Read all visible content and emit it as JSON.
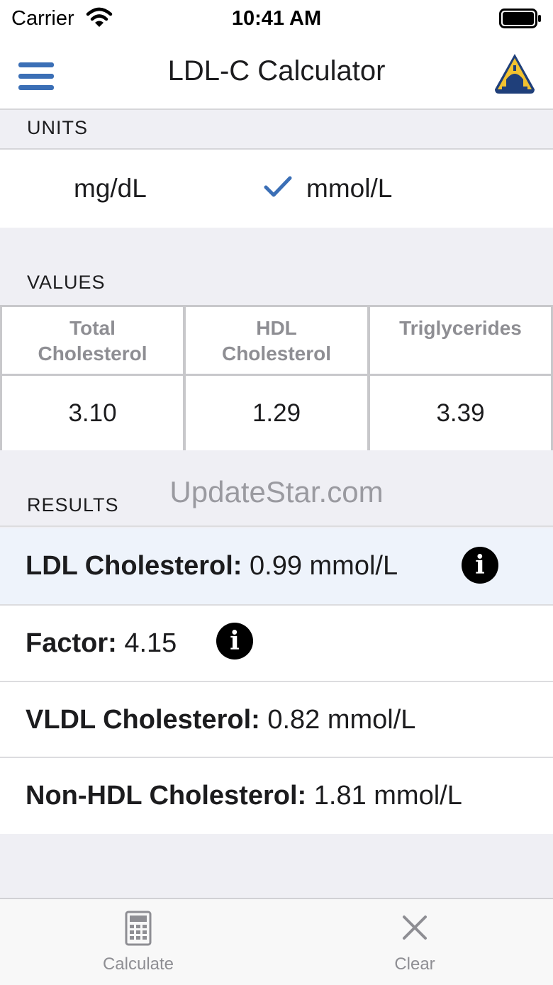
{
  "status_bar": {
    "carrier": "Carrier",
    "time": "10:41 AM"
  },
  "nav": {
    "title": "LDL-C Calculator",
    "menu_icon": "hamburger-menu-icon",
    "logo_icon": "dome-shield-logo"
  },
  "units": {
    "header": "UNITS",
    "options": [
      {
        "label": "mg/dL",
        "selected": false
      },
      {
        "label": "mmol/L",
        "selected": true
      }
    ]
  },
  "values": {
    "header": "VALUES",
    "columns": [
      {
        "line1": "Total",
        "line2": "Cholesterol",
        "value": "3.10"
      },
      {
        "line1": "HDL",
        "line2": "Cholesterol",
        "value": "1.29"
      },
      {
        "line1": "Triglycerides",
        "line2": "",
        "value": "3.39"
      }
    ]
  },
  "results": {
    "header": "RESULTS",
    "watermark": "UpdateStar.com",
    "rows": [
      {
        "label": "LDL Cholesterol:",
        "value": "0.99 mmol/L",
        "has_info": true,
        "highlighted": true
      },
      {
        "label": "Factor:",
        "value": "4.15",
        "has_info": true,
        "highlighted": false
      },
      {
        "label": "VLDL Cholesterol:",
        "value": "0.82 mmol/L",
        "has_info": false,
        "highlighted": false
      },
      {
        "label": "Non-HDL Cholesterol:",
        "value": "1.81 mmol/L",
        "has_info": false,
        "highlighted": false
      }
    ]
  },
  "tab_bar": {
    "calculate": "Calculate",
    "clear": "Clear"
  },
  "colors": {
    "accent": "#3b6fb6",
    "highlight_row": "#eef3fb",
    "section_bg": "#efeff4"
  }
}
